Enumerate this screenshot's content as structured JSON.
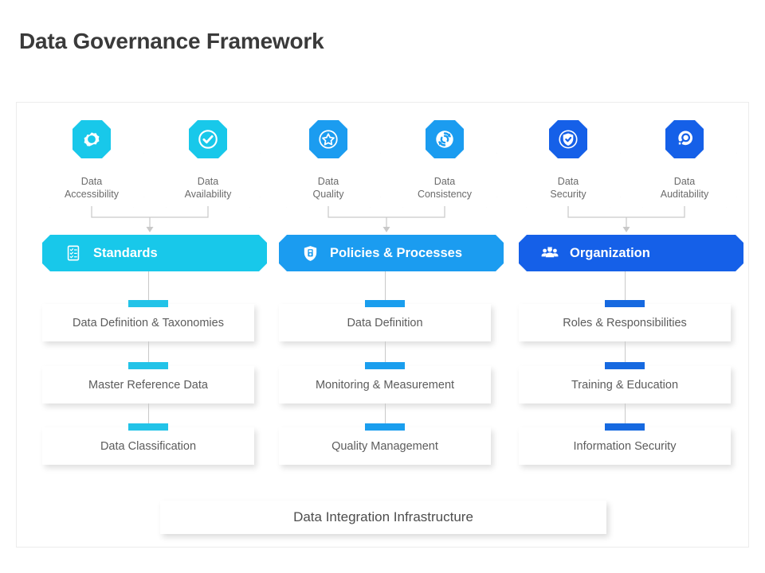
{
  "title": "Data Governance Framework",
  "colors": {
    "cyan": "#18C8EA",
    "blue": "#1B9CF0",
    "dark_blue": "#1560E8",
    "accent_cyan": "#22C3E8",
    "accent_blue": "#1A9EEE",
    "accent_dark": "#1669E0",
    "text": "#5c5c5c",
    "title": "#3a3a3a"
  },
  "columns": [
    {
      "accent": "#22C3E8",
      "banner_color": "#18C8EA",
      "badge_color": "#18C8EA",
      "banner": {
        "label": "Standards",
        "icon": "checklist-icon"
      },
      "capabilities": [
        {
          "label": "Data\nAccessibility",
          "icon": "gear-icon"
        },
        {
          "label": "Data\nAvailability",
          "icon": "check-circle-icon"
        }
      ],
      "items": [
        {
          "label": "Data Definition & Taxonomies"
        },
        {
          "label": "Master Reference Data"
        },
        {
          "label": "Data Classification"
        }
      ]
    },
    {
      "accent": "#1A9EEE",
      "banner_color": "#1B9CF0",
      "badge_color": "#1B9CF0",
      "banner": {
        "label": "Policies & Processes",
        "icon": "shield-document-icon"
      },
      "capabilities": [
        {
          "label": "Data\nQuality",
          "icon": "star-circle-icon"
        },
        {
          "label": "Data\nConsistency",
          "icon": "sync-icon"
        }
      ],
      "items": [
        {
          "label": "Data Definition"
        },
        {
          "label": "Monitoring & Measurement"
        },
        {
          "label": "Quality Management"
        }
      ]
    },
    {
      "accent": "#1669E0",
      "banner_color": "#1560E8",
      "badge_color": "#1560E8",
      "banner": {
        "label": "Organization",
        "icon": "people-group-icon"
      },
      "capabilities": [
        {
          "label": "Data\nSecurity",
          "icon": "shield-check-icon"
        },
        {
          "label": "Data\nAuditability",
          "icon": "magnifier-icon"
        }
      ],
      "items": [
        {
          "label": "Roles & Responsibilities"
        },
        {
          "label": "Training & Education"
        },
        {
          "label": "Information Security"
        }
      ]
    }
  ],
  "footer": {
    "label": "Data Integration Infrastructure"
  }
}
